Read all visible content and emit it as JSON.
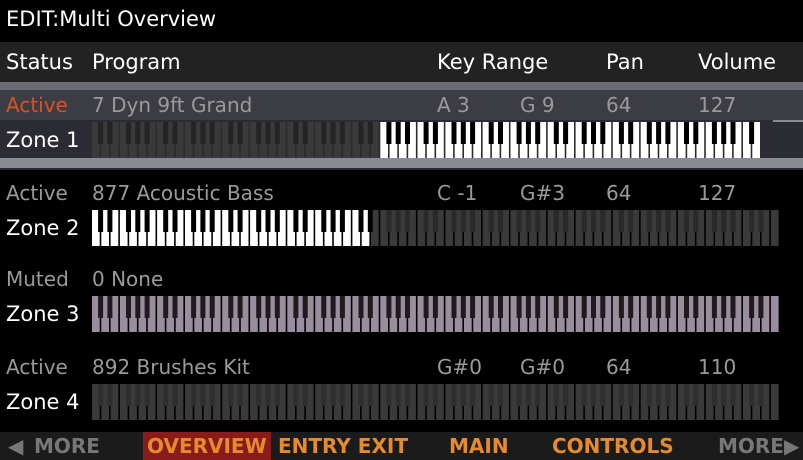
{
  "title": "EDIT:Multi Overview",
  "headers": {
    "status": "Status",
    "program": "Program",
    "key_range": "Key Range",
    "pan": "Pan",
    "volume": "Volume"
  },
  "zones": [
    {
      "status": "Active",
      "program": "7 Dyn 9ft Grand",
      "key_low": "A 3",
      "key_high": "G 9",
      "pan": "64",
      "volume": "127",
      "label": "Zone 1",
      "status_color": "#e0501e"
    },
    {
      "status": "Active",
      "program": "877 Acoustic Bass",
      "key_low": "C -1",
      "key_high": "G#3",
      "pan": "64",
      "volume": "127",
      "label": "Zone 2"
    },
    {
      "status": "Muted",
      "program": "0 None",
      "key_low": "",
      "key_high": "",
      "pan": "",
      "volume": "",
      "label": "Zone 3"
    },
    {
      "status": "Active",
      "program": "892 Brushes Kit",
      "key_low": "G#0",
      "key_high": "G#0",
      "pan": "64",
      "volume": "110",
      "label": "Zone 4"
    }
  ],
  "softkeys": {
    "more_left": "MORE",
    "overview": "OVERVIEW",
    "entry_exit": "ENTRY EXIT",
    "main": "MAIN",
    "controls": "CONTROLS",
    "more_right": "MORE"
  },
  "icons": {
    "left_arrow": "triangle-left-icon",
    "right_arrow": "triangle-right-icon"
  },
  "colors": {
    "accent": "#e68a2e",
    "active_red": "#e0501e",
    "selected_softkey": "#8b1a1a"
  }
}
